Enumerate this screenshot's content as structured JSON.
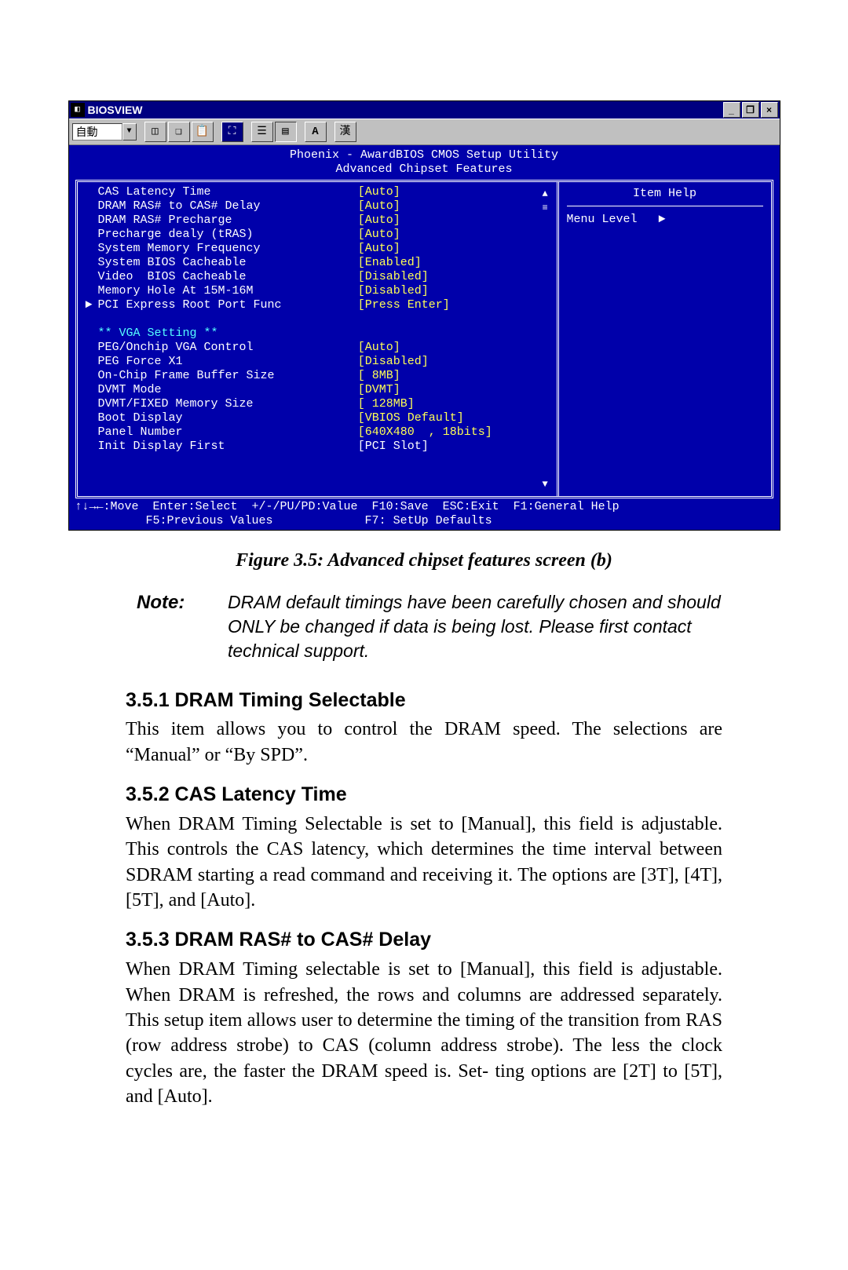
{
  "bios": {
    "window_title": "BIOSVIEW",
    "toolbar_combo": "自動",
    "toolbar_kanji": "漢",
    "header_line1": "Phoenix - AwardBIOS CMOS Setup Utility",
    "header_line2": "Advanced Chipset Features",
    "item_help": "Item Help",
    "menu_level": "Menu Level   ►",
    "settings": [
      {
        "arrow": "",
        "label": "CAS Latency Time",
        "value": "[Auto]"
      },
      {
        "arrow": "",
        "label": "DRAM RAS# to CAS# Delay",
        "value": "[Auto]"
      },
      {
        "arrow": "",
        "label": "DRAM RAS# Precharge",
        "value": "[Auto]"
      },
      {
        "arrow": "",
        "label": "Precharge dealy (tRAS)",
        "value": "[Auto]"
      },
      {
        "arrow": "",
        "label": "System Memory Frequency",
        "value": "[Auto]"
      },
      {
        "arrow": "",
        "label": "System BIOS Cacheable",
        "value": "[Enabled]"
      },
      {
        "arrow": "",
        "label": "Video  BIOS Cacheable",
        "value": "[Disabled]"
      },
      {
        "arrow": "",
        "label": "Memory Hole At 15M-16M",
        "value": "[Disabled]"
      },
      {
        "arrow": "►",
        "label": "PCI Express Root Port Func",
        "value": "[Press Enter]"
      }
    ],
    "vga_header": "** VGA Setting **",
    "vga_settings": [
      {
        "label": "PEG/Onchip VGA Control",
        "value": "[Auto]"
      },
      {
        "label": "PEG Force X1",
        "value": "[Disabled]"
      },
      {
        "label": "On-Chip Frame Buffer Size",
        "value": "[ 8MB]"
      },
      {
        "label": "DVMT Mode",
        "value": "[DVMT]"
      },
      {
        "label": "DVMT/FIXED Memory Size",
        "value": "[ 128MB]"
      },
      {
        "label": "Boot Display",
        "value": "[VBIOS Default]"
      },
      {
        "label": "Panel Number",
        "value": "[640X480  , 18bits]"
      },
      {
        "label": "Init Display First",
        "value": "[PCI Slot]"
      }
    ],
    "footer_line1": "↑↓→←:Move  Enter:Select  +/-/PU/PD:Value  F10:Save  ESC:Exit  F1:General Help",
    "footer_line2": "          F5:Previous Values             F7: SetUp Defaults"
  },
  "doc": {
    "caption": "Figure 3.5: Advanced chipset features screen (b)",
    "note_label": "Note:",
    "note_text": "DRAM default timings have been carefully chosen and should ONLY be changed if data is being lost. Please first contact technical support.",
    "s1_h": "3.5.1 DRAM Timing Selectable",
    "s1_p": "This item allows you to control the DRAM speed. The selections are “Manual” or “By SPD”.",
    "s2_h": "3.5.2 CAS Latency Time",
    "s2_p": "When DRAM Timing Selectable is set to [Manual], this field is adjustable. This controls the CAS latency, which determines the time interval between SDRAM starting a read command and receiving it. The options are [3T], [4T], [5T], and [Auto].",
    "s3_h": "3.5.3 DRAM RAS# to CAS# Delay",
    "s3_p": "When DRAM Timing selectable is set to [Manual], this field is adjustable. When DRAM is refreshed, the rows and columns are addressed separately. This setup item allows user to determine the timing of the transition from RAS (row address strobe) to CAS (column address strobe). The less the clock cycles are, the faster the DRAM speed is. Set- ting options are [2T] to [5T], and [Auto]."
  }
}
